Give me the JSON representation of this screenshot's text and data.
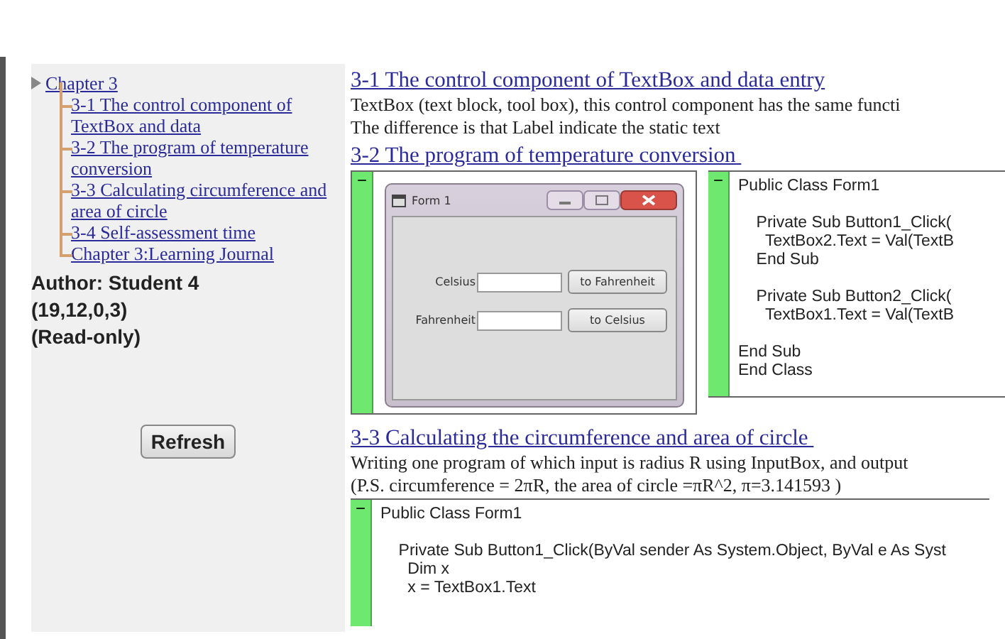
{
  "sidebar": {
    "tree": {
      "label": "Chapter 3",
      "children": [
        {
          "label": "3-1 The control component of TextBox and data"
        },
        {
          "label": "3-2 The program of temperature conversion "
        },
        {
          "label": "3-3 Calculating circumference and area of circle"
        },
        {
          "label": "3-4 Self-assessment time"
        },
        {
          "label": "Chapter 3:Learning Journal"
        }
      ]
    },
    "author_lines": [
      "Author: Student 4",
      "(19,12,0,3)",
      "(Read-only)"
    ],
    "refresh_button": "Refresh"
  },
  "sections": [
    {
      "heading": "3-1 The control component of TextBox and data entry",
      "paragraphs": [
        "TextBox (text block, tool box), this control component has the same functi",
        "The difference is that Label indicate the static text"
      ]
    },
    {
      "heading": "3-2 The program of temperature conversion ",
      "blocks": [
        {
          "kind": "form",
          "toggle": "−",
          "title": "Form 1",
          "rows": [
            {
              "label": "Celsius",
              "button": "to Fahrenheit"
            },
            {
              "label": "Fahrenheit",
              "button": "to Celsius"
            }
          ]
        },
        {
          "kind": "code",
          "toggle": "−",
          "groups": [
            [
              "Public Class Form1"
            ],
            [
              "    Private Sub Button1_Click(",
              "      TextBox2.Text = Val(TextB",
              "    End Sub"
            ],
            [
              "    Private Sub Button2_Click(",
              "      TextBox1.Text = Val(TextB"
            ],
            [
              "End Sub",
              "End Class"
            ]
          ]
        }
      ]
    },
    {
      "heading": "3-3 Calculating the circumference and area of circle ",
      "paragraphs": [
        "Writing one program of which input is radius R using InputBox, and output",
        "(P.S. circumference = 2πR, the area of circle =πR^2, π=3.141593 )"
      ],
      "blocks": [
        {
          "kind": "code",
          "toggle": "−",
          "groups": [
            [
              "Public Class Form1"
            ],
            [
              "    Private Sub Button1_Click(ByVal sender As System.Object, ByVal e As Syst",
              "      Dim x",
              "      x = TextBox1.Text"
            ]
          ]
        }
      ]
    }
  ]
}
